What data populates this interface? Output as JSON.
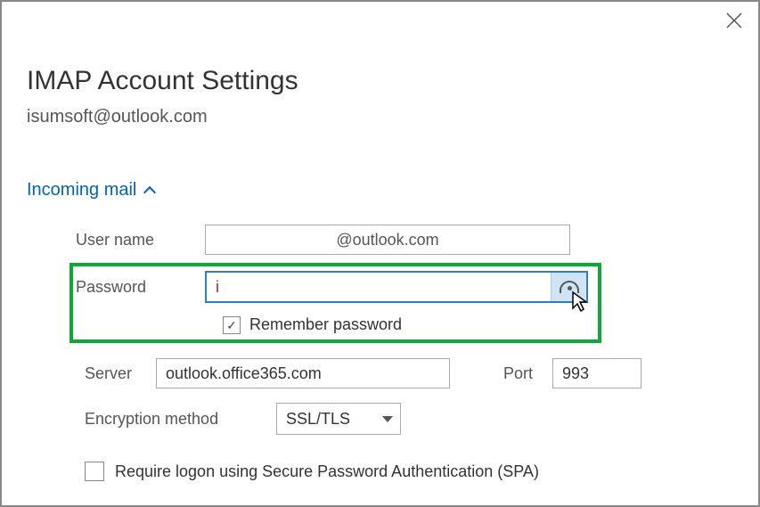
{
  "dialog": {
    "title": "IMAP Account Settings",
    "email": "isumsoft@outlook.com"
  },
  "section": {
    "incoming_label": "Incoming mail"
  },
  "fields": {
    "username_label": "User name",
    "username_value": "           @outlook.com",
    "password_label": "Password",
    "password_value": "i            ",
    "remember_label": "Remember password",
    "remember_checked": true,
    "server_label": "Server",
    "server_value": "outlook.office365.com",
    "port_label": "Port",
    "port_value": "993",
    "encryption_label": "Encryption method",
    "encryption_value": "SSL/TLS",
    "spa_label": "Require logon using Secure Password Authentication (SPA)",
    "spa_checked": false
  }
}
